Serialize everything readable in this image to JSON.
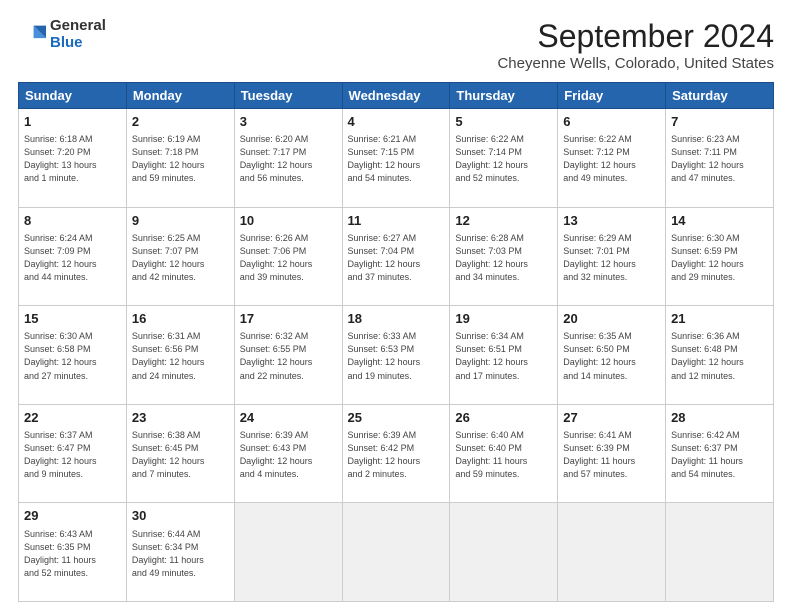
{
  "header": {
    "logo_general": "General",
    "logo_blue": "Blue",
    "month_title": "September 2024",
    "subtitle": "Cheyenne Wells, Colorado, United States"
  },
  "weekdays": [
    "Sunday",
    "Monday",
    "Tuesday",
    "Wednesday",
    "Thursday",
    "Friday",
    "Saturday"
  ],
  "weeks": [
    [
      {
        "day": "1",
        "info": "Sunrise: 6:18 AM\nSunset: 7:20 PM\nDaylight: 13 hours\nand 1 minute."
      },
      {
        "day": "2",
        "info": "Sunrise: 6:19 AM\nSunset: 7:18 PM\nDaylight: 12 hours\nand 59 minutes."
      },
      {
        "day": "3",
        "info": "Sunrise: 6:20 AM\nSunset: 7:17 PM\nDaylight: 12 hours\nand 56 minutes."
      },
      {
        "day": "4",
        "info": "Sunrise: 6:21 AM\nSunset: 7:15 PM\nDaylight: 12 hours\nand 54 minutes."
      },
      {
        "day": "5",
        "info": "Sunrise: 6:22 AM\nSunset: 7:14 PM\nDaylight: 12 hours\nand 52 minutes."
      },
      {
        "day": "6",
        "info": "Sunrise: 6:22 AM\nSunset: 7:12 PM\nDaylight: 12 hours\nand 49 minutes."
      },
      {
        "day": "7",
        "info": "Sunrise: 6:23 AM\nSunset: 7:11 PM\nDaylight: 12 hours\nand 47 minutes."
      }
    ],
    [
      {
        "day": "8",
        "info": "Sunrise: 6:24 AM\nSunset: 7:09 PM\nDaylight: 12 hours\nand 44 minutes."
      },
      {
        "day": "9",
        "info": "Sunrise: 6:25 AM\nSunset: 7:07 PM\nDaylight: 12 hours\nand 42 minutes."
      },
      {
        "day": "10",
        "info": "Sunrise: 6:26 AM\nSunset: 7:06 PM\nDaylight: 12 hours\nand 39 minutes."
      },
      {
        "day": "11",
        "info": "Sunrise: 6:27 AM\nSunset: 7:04 PM\nDaylight: 12 hours\nand 37 minutes."
      },
      {
        "day": "12",
        "info": "Sunrise: 6:28 AM\nSunset: 7:03 PM\nDaylight: 12 hours\nand 34 minutes."
      },
      {
        "day": "13",
        "info": "Sunrise: 6:29 AM\nSunset: 7:01 PM\nDaylight: 12 hours\nand 32 minutes."
      },
      {
        "day": "14",
        "info": "Sunrise: 6:30 AM\nSunset: 6:59 PM\nDaylight: 12 hours\nand 29 minutes."
      }
    ],
    [
      {
        "day": "15",
        "info": "Sunrise: 6:30 AM\nSunset: 6:58 PM\nDaylight: 12 hours\nand 27 minutes."
      },
      {
        "day": "16",
        "info": "Sunrise: 6:31 AM\nSunset: 6:56 PM\nDaylight: 12 hours\nand 24 minutes."
      },
      {
        "day": "17",
        "info": "Sunrise: 6:32 AM\nSunset: 6:55 PM\nDaylight: 12 hours\nand 22 minutes."
      },
      {
        "day": "18",
        "info": "Sunrise: 6:33 AM\nSunset: 6:53 PM\nDaylight: 12 hours\nand 19 minutes."
      },
      {
        "day": "19",
        "info": "Sunrise: 6:34 AM\nSunset: 6:51 PM\nDaylight: 12 hours\nand 17 minutes."
      },
      {
        "day": "20",
        "info": "Sunrise: 6:35 AM\nSunset: 6:50 PM\nDaylight: 12 hours\nand 14 minutes."
      },
      {
        "day": "21",
        "info": "Sunrise: 6:36 AM\nSunset: 6:48 PM\nDaylight: 12 hours\nand 12 minutes."
      }
    ],
    [
      {
        "day": "22",
        "info": "Sunrise: 6:37 AM\nSunset: 6:47 PM\nDaylight: 12 hours\nand 9 minutes."
      },
      {
        "day": "23",
        "info": "Sunrise: 6:38 AM\nSunset: 6:45 PM\nDaylight: 12 hours\nand 7 minutes."
      },
      {
        "day": "24",
        "info": "Sunrise: 6:39 AM\nSunset: 6:43 PM\nDaylight: 12 hours\nand 4 minutes."
      },
      {
        "day": "25",
        "info": "Sunrise: 6:39 AM\nSunset: 6:42 PM\nDaylight: 12 hours\nand 2 minutes."
      },
      {
        "day": "26",
        "info": "Sunrise: 6:40 AM\nSunset: 6:40 PM\nDaylight: 11 hours\nand 59 minutes."
      },
      {
        "day": "27",
        "info": "Sunrise: 6:41 AM\nSunset: 6:39 PM\nDaylight: 11 hours\nand 57 minutes."
      },
      {
        "day": "28",
        "info": "Sunrise: 6:42 AM\nSunset: 6:37 PM\nDaylight: 11 hours\nand 54 minutes."
      }
    ],
    [
      {
        "day": "29",
        "info": "Sunrise: 6:43 AM\nSunset: 6:35 PM\nDaylight: 11 hours\nand 52 minutes."
      },
      {
        "day": "30",
        "info": "Sunrise: 6:44 AM\nSunset: 6:34 PM\nDaylight: 11 hours\nand 49 minutes."
      },
      {
        "day": "",
        "info": "",
        "empty": true
      },
      {
        "day": "",
        "info": "",
        "empty": true
      },
      {
        "day": "",
        "info": "",
        "empty": true
      },
      {
        "day": "",
        "info": "",
        "empty": true
      },
      {
        "day": "",
        "info": "",
        "empty": true
      }
    ]
  ]
}
